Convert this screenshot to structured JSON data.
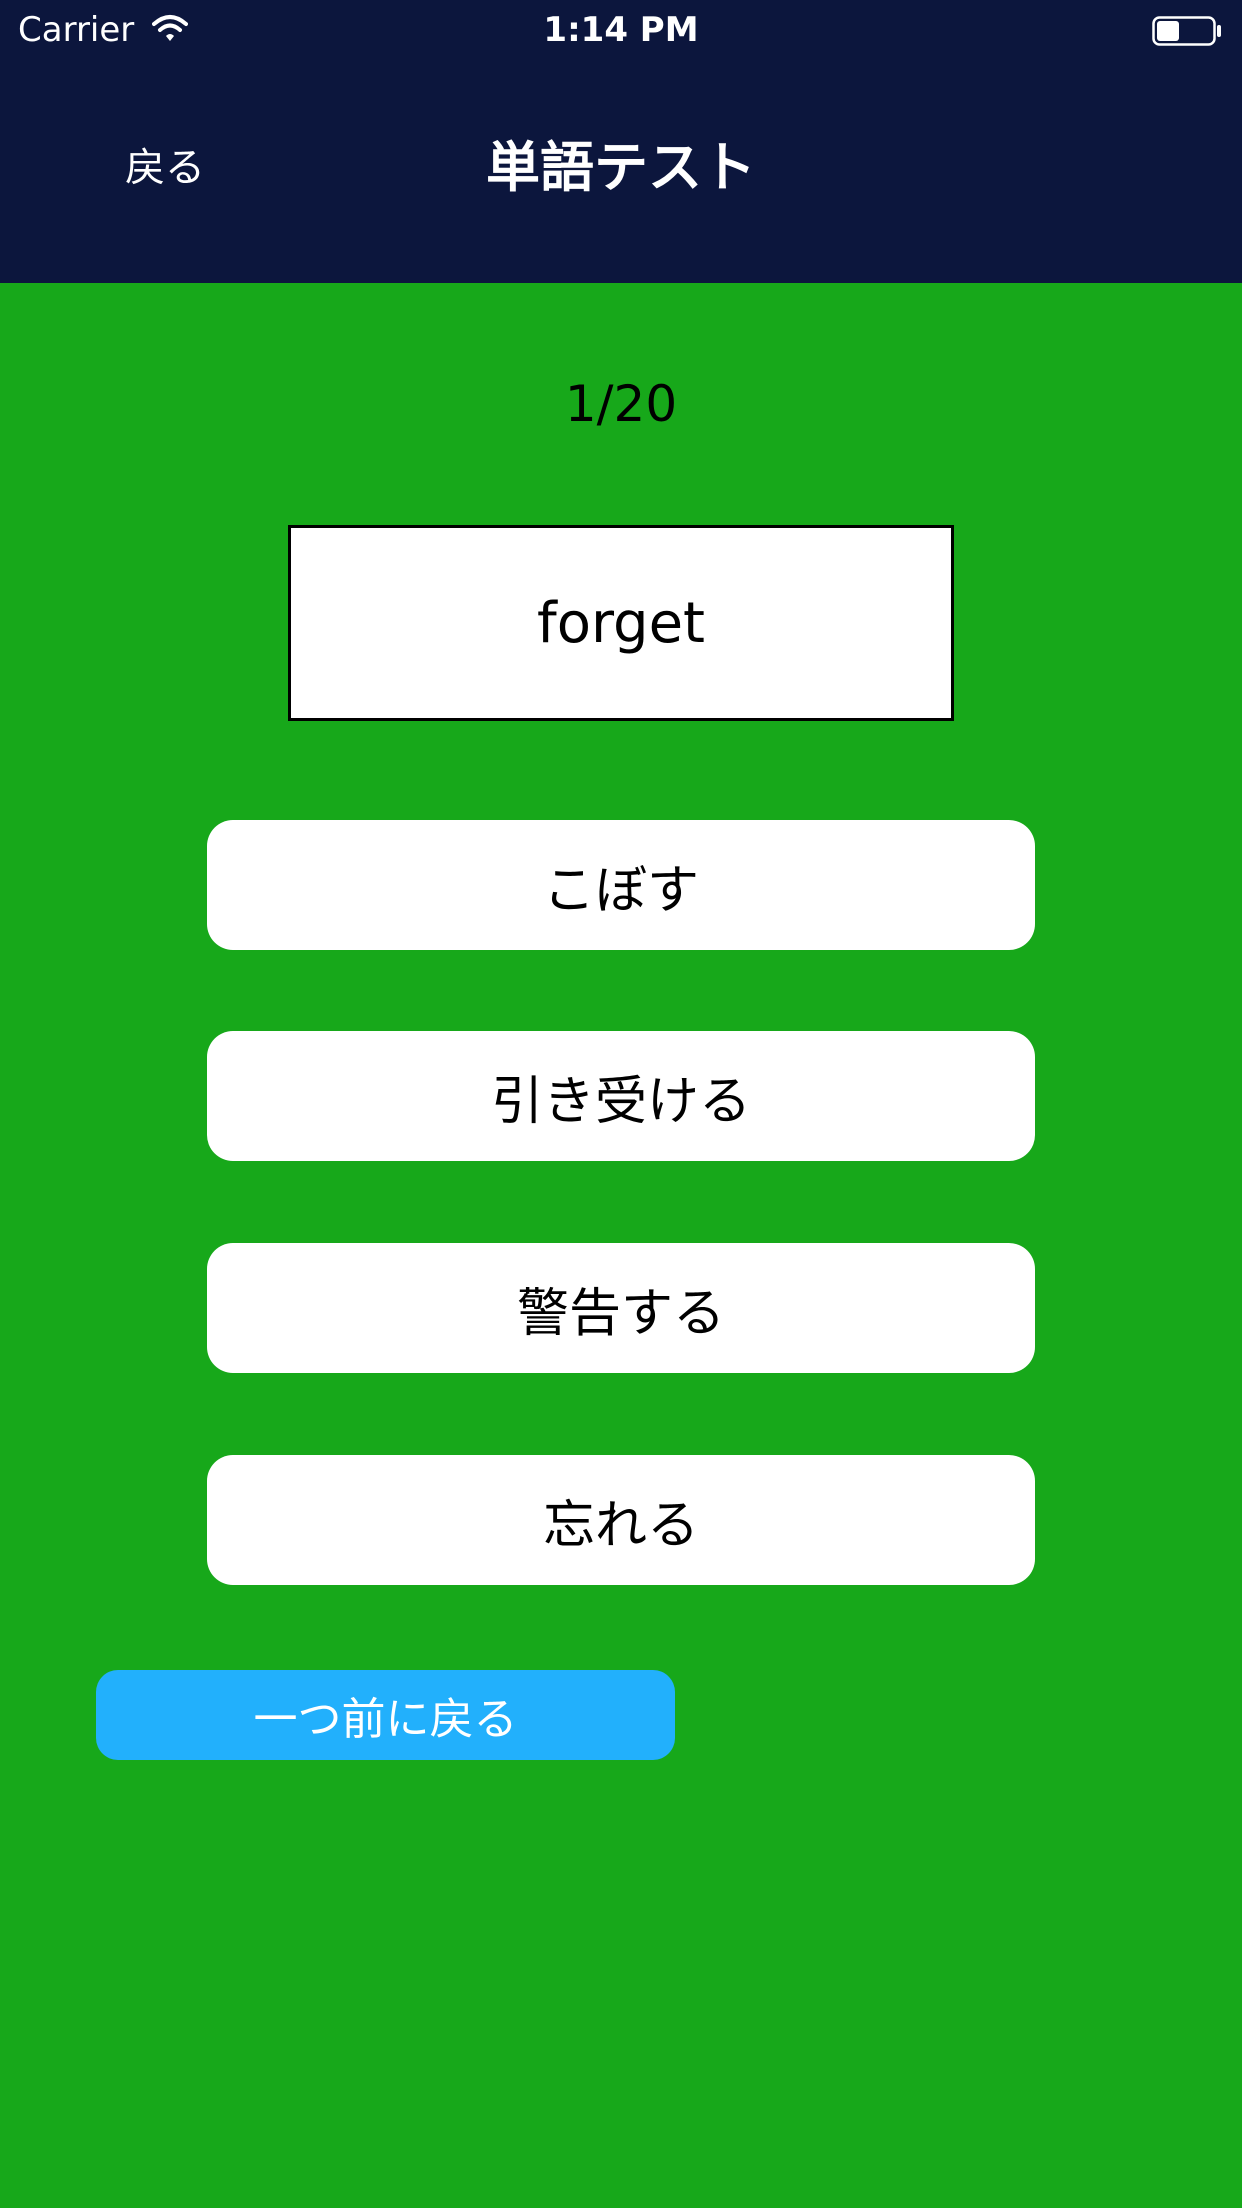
{
  "status_bar": {
    "carrier": "Carrier",
    "time": "1:14 PM",
    "wifi_icon": "wifi-icon",
    "battery_icon": "battery-icon"
  },
  "nav": {
    "back_label": "戻る",
    "title": "単語テスト"
  },
  "quiz": {
    "progress": "1/20",
    "word": "forget",
    "answers": [
      "こぼす",
      "引き受ける",
      "警告する",
      "忘れる"
    ],
    "previous_label": "一つ前に戻る"
  },
  "colors": {
    "header_bg": "#0c163d",
    "screen_bg": "#17a81a",
    "answer_bg": "#ffffff",
    "previous_button_bg": "#22b0fc"
  }
}
